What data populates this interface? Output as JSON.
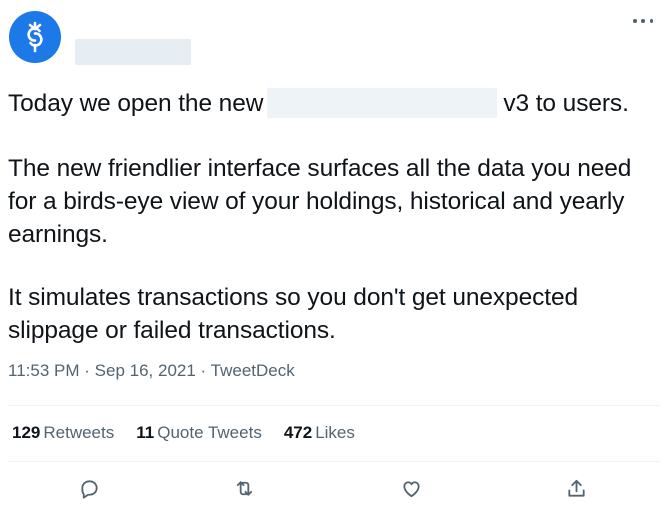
{
  "tweet": {
    "avatar_icon": "yearn-logo-icon",
    "accent_color": "#1d78e8",
    "text_line1_before": "Today we open the new",
    "text_line1_after": "v3 to users.",
    "paragraph2": "The new friendlier interface surfaces all the data you need for a birds-eye view of your holdings, historical and yearly earnings.",
    "paragraph3": "It simulates transactions so you don't get unexpected slippage or failed transactions.",
    "time": "11:53 PM",
    "date": "Sep 16, 2021",
    "source": "TweetDeck",
    "separator": "·"
  },
  "stats": {
    "retweets_count": "129",
    "retweets_label": "Retweets",
    "quotes_count": "11",
    "quotes_label": "Quote Tweets",
    "likes_count": "472",
    "likes_label": "Likes"
  },
  "actions": [
    {
      "icon": "reply-icon"
    },
    {
      "icon": "retweet-icon"
    },
    {
      "icon": "like-icon"
    },
    {
      "icon": "share-icon"
    }
  ]
}
